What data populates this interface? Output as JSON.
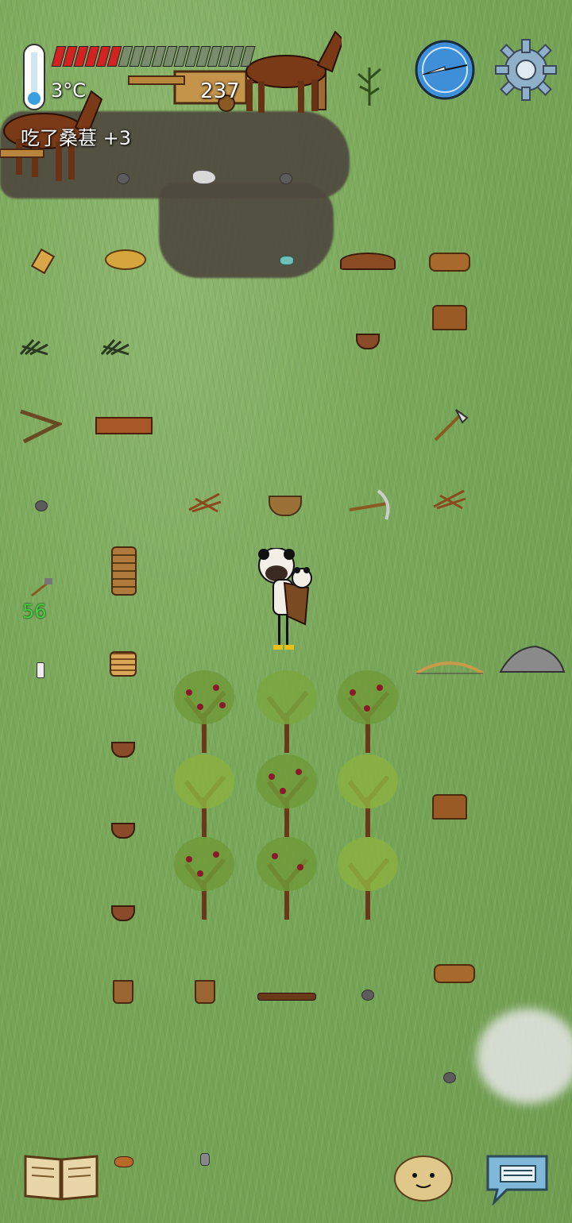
{
  "hud": {
    "temperature": "3°C",
    "health_segments_filled": 6,
    "health_segments_total": 18,
    "counter": "237",
    "message": "吃了桑葚 +3",
    "age_or_timer": "56"
  },
  "icons": {
    "thermometer": "thermometer-icon",
    "compass": "compass-icon",
    "settings": "gear-icon",
    "recipe_book": "book-icon",
    "emote": "face-icon",
    "chat": "keyboard-chat-icon"
  },
  "colors": {
    "grass": "#7aa85a",
    "mud": "#4f4a3f",
    "health_red": "#d22222",
    "timer_green": "#3fd13f"
  },
  "world": {
    "berry_bushes": 9,
    "horses": 2
  }
}
